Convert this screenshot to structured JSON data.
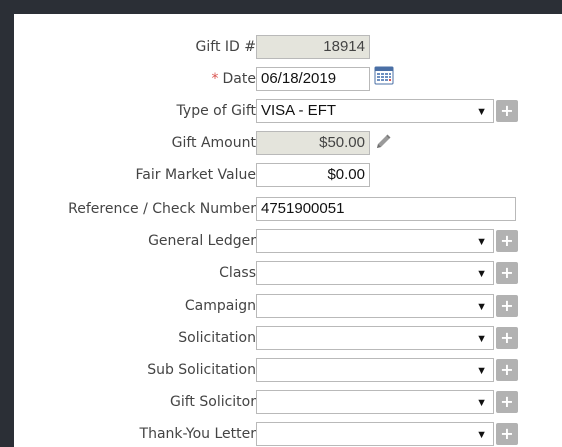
{
  "form": {
    "gift_id": {
      "label": "Gift ID #",
      "value": "18914"
    },
    "date": {
      "required_marker": "*",
      "label": "Date",
      "value": "06/18/2019"
    },
    "type_of_gift": {
      "label": "Type of Gift",
      "value": "VISA - EFT"
    },
    "gift_amount": {
      "label": "Gift Amount",
      "value": "$50.00"
    },
    "fair_market_value": {
      "label": "Fair Market Value",
      "value": "$0.00"
    },
    "reference_check_number": {
      "label": "Reference / Check Number",
      "value": "4751900051"
    },
    "general_ledger": {
      "label": "General Ledger",
      "value": ""
    },
    "class": {
      "label": "Class",
      "value": ""
    },
    "campaign": {
      "label": "Campaign",
      "value": ""
    },
    "solicitation": {
      "label": "Solicitation",
      "value": ""
    },
    "sub_solicitation": {
      "label": "Sub Solicitation",
      "value": ""
    },
    "gift_solicitor": {
      "label": "Gift Solicitor",
      "value": ""
    },
    "thank_you_letter": {
      "label": "Thank-You Letter",
      "value": ""
    }
  },
  "glyphs": {
    "dropdown_arrow": "▼",
    "add": "+"
  },
  "icons": [
    "calendar-icon",
    "pencil-icon",
    "chevron-down-icon",
    "plus-icon"
  ],
  "colors": {
    "required": "#d9534f",
    "readonly_bg": "#e4e4dc",
    "add_button_bg": "#b2b2b2"
  }
}
